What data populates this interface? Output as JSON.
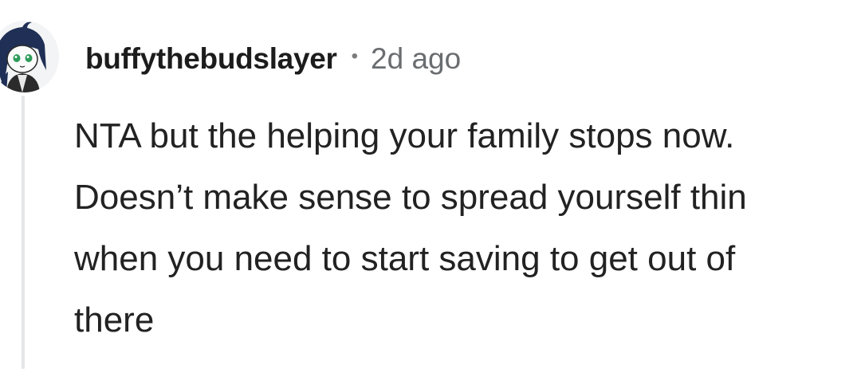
{
  "comment": {
    "author": "buffythebudslayer",
    "separator": "•",
    "timestamp": "2d ago",
    "avatar_icon": "anime-character-avatar",
    "text": "NTA but the helping your family stops now. Doesn’t make sense to spread yourself thin when you need to start saving to get out of there"
  },
  "colors": {
    "background": "#ffffff",
    "text": "#1c1c1c",
    "meta": "#6a6d70",
    "thread_line": "#e4e6e8"
  }
}
